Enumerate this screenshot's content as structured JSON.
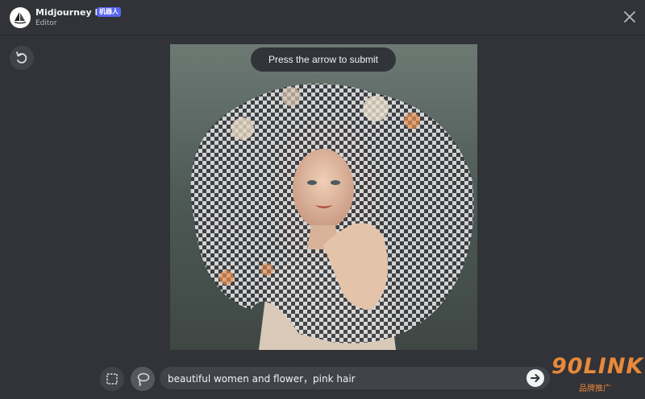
{
  "header": {
    "bot_name": "Midjourney Bot",
    "bot_tag": "机器人",
    "subtitle": "Editor"
  },
  "editor": {
    "tooltip": "Press the arrow to submit"
  },
  "prompt": {
    "value": "beautiful women and flower，pink hair"
  },
  "watermark": {
    "brand": "90LINK",
    "tagline": "品牌推广"
  },
  "icons": {
    "close": "close-icon",
    "undo": "undo-icon",
    "rect_select": "rectangle-select-icon",
    "lasso": "lasso-select-icon",
    "submit": "arrow-right-icon"
  },
  "colors": {
    "background": "#313338",
    "accent": "#5865f2",
    "watermark": "#e8893a"
  }
}
